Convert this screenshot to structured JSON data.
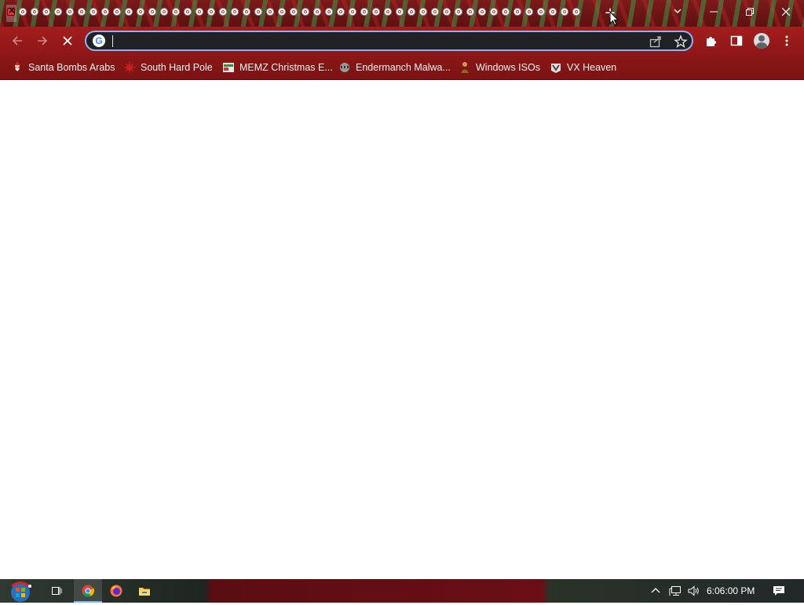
{
  "tab_strip": {
    "tab_count": 49,
    "new_tab_label": "+",
    "tab_search_icon": "chevron-down-icon",
    "window_controls": [
      "minimize-icon",
      "restore-icon",
      "close-icon"
    ]
  },
  "toolbar": {
    "back_icon": "arrow-left-icon",
    "forward_icon": "arrow-right-icon",
    "stop_icon": "close-icon",
    "omnibox": {
      "value": "",
      "engine_icon": "google-icon",
      "engine_letter": "G"
    },
    "actions": [
      "share-icon",
      "star-icon",
      "puzzle-icon",
      "side-panel-icon",
      "profile-icon",
      "kebab-menu-icon"
    ]
  },
  "bookmarks": [
    {
      "label": "Santa Bombs Arabs",
      "icon": "santa-icon"
    },
    {
      "label": "South Hard Pole",
      "icon": "virus-icon"
    },
    {
      "label": "MEMZ Christmas E...",
      "icon": "memz-icon"
    },
    {
      "label": "Endermanch Malwa...",
      "icon": "raccoon-icon"
    },
    {
      "label": "Windows ISOs",
      "icon": "person-icon"
    },
    {
      "label": "VX Heaven",
      "icon": "vx-icon"
    }
  ],
  "taskbar": {
    "pinned": [
      "start-orb-icon",
      "task-view-icon",
      "chrome-icon",
      "firefox-icon",
      "file-explorer-icon"
    ],
    "tray": [
      "chevron-up-icon",
      "network-icon",
      "volume-icon",
      "notifications-icon"
    ],
    "clock": "6:06:00 PM"
  },
  "colors": {
    "theme_red": "#8e1717",
    "omnibox_bg": "#202124",
    "focus_ring": "#8ab4f8"
  }
}
